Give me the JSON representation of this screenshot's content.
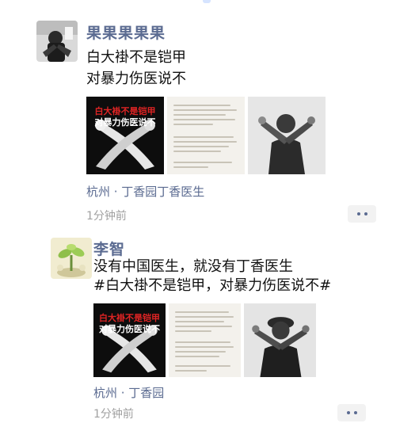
{
  "colors": {
    "nickname": "#5b6b91",
    "poster_red": "#e02424",
    "time": "#a0a0a0"
  },
  "posts": [
    {
      "author": "果果果果果",
      "avatar_icon": "user-avatar-photo",
      "lines": [
        "白大褂不是铠甲",
        "对暴力伤医说不"
      ],
      "images": [
        {
          "kind": "poster",
          "title_red": "白大褂不是铠甲",
          "title_white": "对暴力伤医说不"
        },
        {
          "kind": "document"
        },
        {
          "kind": "person"
        }
      ],
      "location": "杭州 · 丁香园丁香医生",
      "time": "1分钟前",
      "more_icon": "more-dots-icon"
    },
    {
      "author": "李智",
      "avatar_icon": "plant-avatar-photo",
      "lines": [
        "没有中国医生，就没有丁香医生",
        "#白大褂不是铠甲，对暴力伤医说不#"
      ],
      "images": [
        {
          "kind": "poster",
          "title_red": "白大褂不是铠甲",
          "title_white": "对暴力伤医说不"
        },
        {
          "kind": "document"
        },
        {
          "kind": "person"
        }
      ],
      "location": "杭州 · 丁香园",
      "time": "1分钟前",
      "more_icon": "more-dots-icon"
    }
  ]
}
